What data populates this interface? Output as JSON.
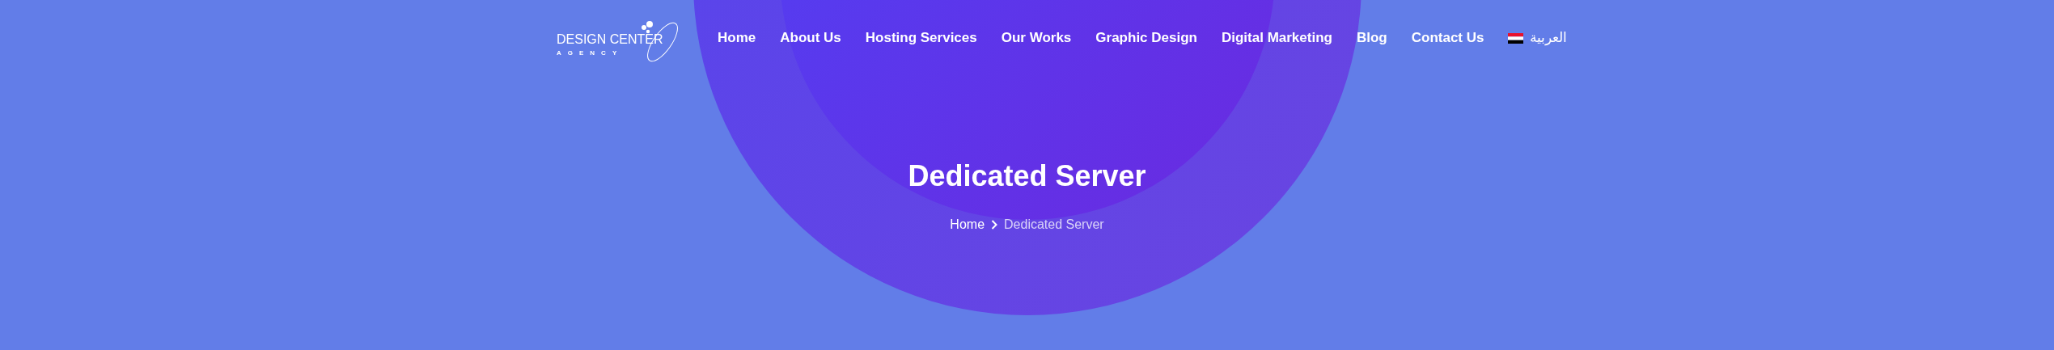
{
  "logo": {
    "name": "DESIGN CENTER",
    "tagline": "AGENCY"
  },
  "nav": [
    {
      "label": "Home",
      "kind": "link"
    },
    {
      "label": "About Us",
      "kind": "link"
    },
    {
      "label": "Hosting Services",
      "kind": "link"
    },
    {
      "label": "Our Works",
      "kind": "link"
    },
    {
      "label": "Graphic Design",
      "kind": "link"
    },
    {
      "label": "Digital Marketing",
      "kind": "link"
    },
    {
      "label": "Blog",
      "kind": "link"
    },
    {
      "label": "Contact Us",
      "kind": "link"
    },
    {
      "label": "العربية",
      "kind": "language"
    }
  ],
  "hero": {
    "title": "Dedicated Server",
    "breadcrumb": [
      {
        "label": "Home",
        "current": false
      },
      {
        "label": "Dedicated Server",
        "current": true
      }
    ]
  }
}
